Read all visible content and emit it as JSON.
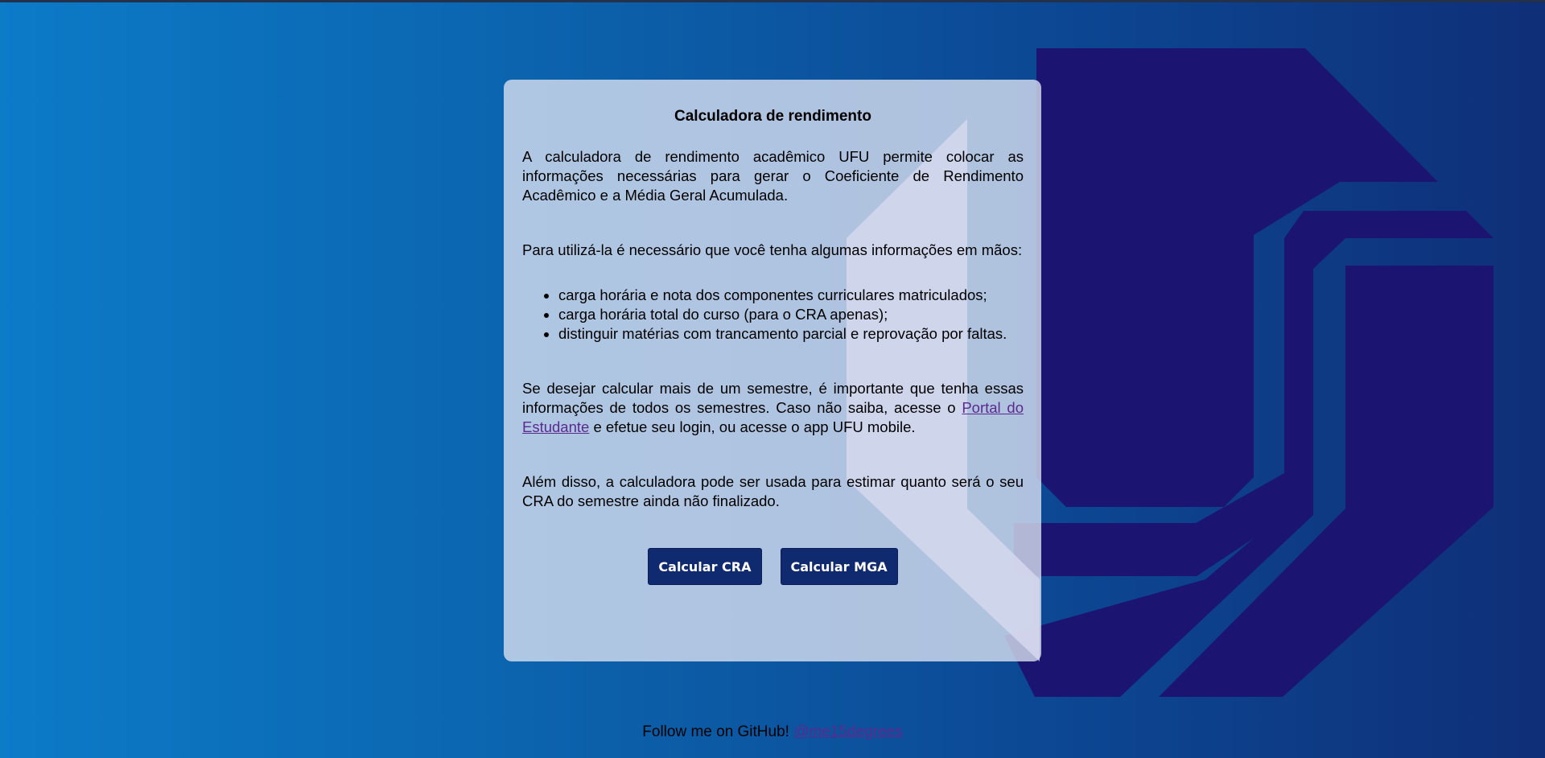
{
  "card": {
    "title": "Calculadora de rendimento",
    "intro": "A calculadora de rendimento acadêmico UFU permite colocar as informações necessárias para gerar o Coeficiente de Rendimento Acadêmico e a Média Geral Acumulada.",
    "usage": "Para utilizá-la é necessário que você tenha algumas informações em mãos:",
    "requirements": [
      "carga horária e nota dos componentes curriculares matriculados;",
      "carga horária total do curso (para o CRA apenas);",
      "distinguir matérias com trancamento parcial e reprovação por faltas."
    ],
    "semester_text_before": "Se desejar calcular mais de um semestre, é importante que tenha essas informações de todos os semestres. Caso não saiba, acesse o ",
    "portal_link": "Portal do Estudante",
    "semester_text_after": " e efetue seu login, ou acesse o app UFU mobile.",
    "estimate": "Além disso, a calculadora pode ser usada para estimar quanto será o seu CRA do semestre ainda não finalizado.",
    "buttons": {
      "cra": "Calcular CRA",
      "mga": "Calcular MGA"
    }
  },
  "footer": {
    "text": "Follow me on GitHub! ",
    "link": "@me15degrees"
  },
  "colors": {
    "logo_dark": "#1b1470",
    "logo_pink": "#c9b8de",
    "button_bg": "#102a70",
    "link": "#5b2a8f"
  },
  "icons": {
    "logo": "ufu-logo"
  }
}
